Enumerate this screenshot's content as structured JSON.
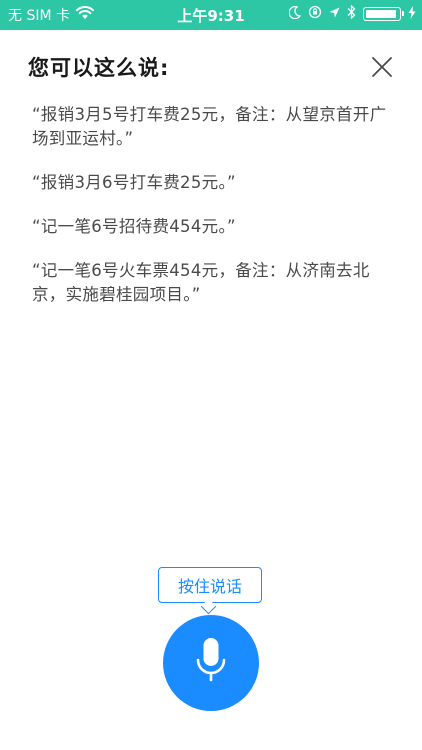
{
  "status_bar": {
    "carrier": "无 SIM 卡",
    "time": "上午9:31",
    "icons": [
      "wifi-icon",
      "moon-icon",
      "orientation-lock-icon",
      "location-icon",
      "bluetooth-icon",
      "battery-icon",
      "charging-icon"
    ],
    "background": "#2ec7a5"
  },
  "header": {
    "title": "您可以这么说:",
    "close_icon": "close-icon"
  },
  "tips": [
    "“报销3月5号打车费25元，备注：从望京首开广场到亚运村。”",
    "“报销3月6号打车费25元。”",
    "“记一笔6号招待费454元。”",
    "“记一笔6号火车票454元，备注：从济南去北京，实施碧桂园项目。”"
  ],
  "voice": {
    "hint": "按住说话",
    "button_icon": "microphone-icon",
    "accent": "#1a8cff"
  }
}
